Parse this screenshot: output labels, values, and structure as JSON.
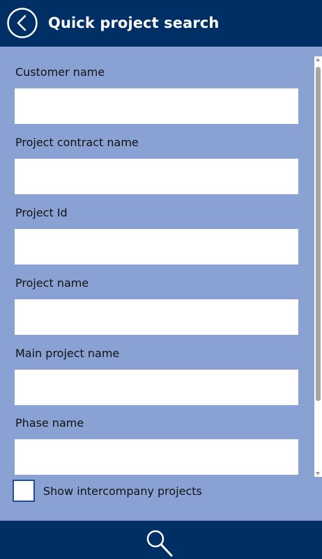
{
  "header": {
    "title": "Quick project search",
    "back_icon": "chevron-left-circle-icon"
  },
  "form": {
    "fields": [
      {
        "label": "Customer name",
        "value": ""
      },
      {
        "label": "Project contract name",
        "value": ""
      },
      {
        "label": "Project Id",
        "value": ""
      },
      {
        "label": "Project name",
        "value": ""
      },
      {
        "label": "Main project name",
        "value": ""
      },
      {
        "label": "Phase name",
        "value": ""
      }
    ],
    "intercompany": {
      "label": "Show intercompany projects",
      "checked": false
    }
  },
  "footer": {
    "search_icon": "search-icon"
  },
  "colors": {
    "header_bg": "#002f66",
    "content_bg": "#8aa1d4",
    "input_bg": "#ffffff",
    "checkbox_border": "#1f4f9a"
  }
}
